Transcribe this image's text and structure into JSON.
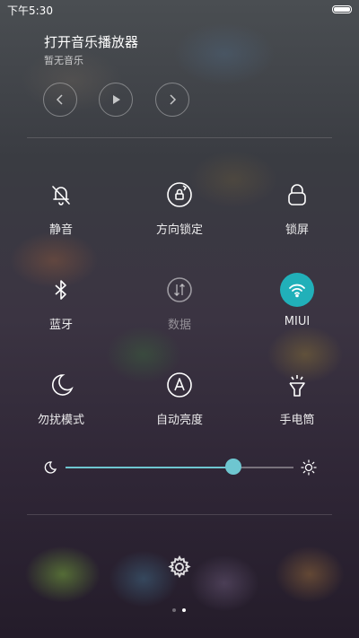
{
  "status_bar": {
    "time": "下午5:30"
  },
  "music": {
    "title": "打开音乐播放器",
    "subtitle": "暂无音乐",
    "prev_icon": "chevron-left-icon",
    "play_icon": "play-icon",
    "next_icon": "chevron-right-icon"
  },
  "toggles": [
    {
      "label": "静音",
      "icon": "bell-off-icon",
      "active": false
    },
    {
      "label": "方向锁定",
      "icon": "rotation-lock-icon",
      "active": false
    },
    {
      "label": "锁屏",
      "icon": "lock-icon",
      "active": false
    },
    {
      "label": "蓝牙",
      "icon": "bluetooth-icon",
      "active": false
    },
    {
      "label": "数据",
      "icon": "mobile-data-icon",
      "active": false,
      "disabled": true
    },
    {
      "label": "MIUI",
      "icon": "wifi-icon",
      "active": true
    },
    {
      "label": "勿扰模式",
      "icon": "moon-icon",
      "active": false
    },
    {
      "label": "自动亮度",
      "icon": "auto-brightness-icon",
      "active": false
    },
    {
      "label": "手电筒",
      "icon": "flashlight-icon",
      "active": false
    }
  ],
  "brightness": {
    "value": 0.738,
    "min_icon": "moon-icon",
    "max_icon": "sun-icon"
  },
  "settings_icon": "gear-icon",
  "pager": {
    "pages": 2,
    "current": 2
  },
  "colors": {
    "accent": "#21b0b9",
    "slider": "#6ec6d0"
  }
}
